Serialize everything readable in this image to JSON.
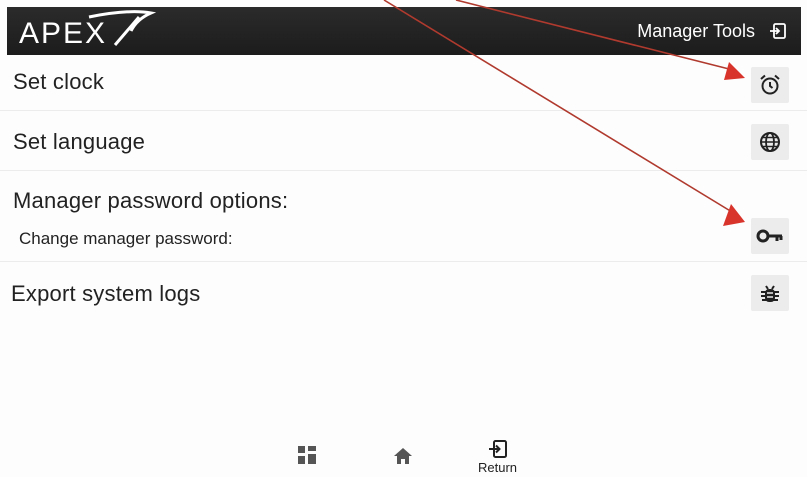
{
  "header": {
    "logo_text": "APEX",
    "title": "Manager Tools"
  },
  "rows": {
    "set_clock": "Set clock",
    "set_language": "Set language",
    "password_heading": "Manager password options:",
    "change_password": "Change manager password:",
    "export_logs": "Export system logs"
  },
  "nav": {
    "return_label": "Return"
  },
  "colors": {
    "header_bg": "#1c1c1c",
    "button_bg": "#ececec",
    "annotation_arrow": "#c0392b"
  },
  "icons": {
    "exit": "exit-icon",
    "clock": "alarm-clock-icon",
    "language": "globe-icon",
    "password": "key-icon",
    "logs": "bug-icon",
    "apps": "grid-icon",
    "home": "home-icon",
    "return": "return-icon"
  }
}
